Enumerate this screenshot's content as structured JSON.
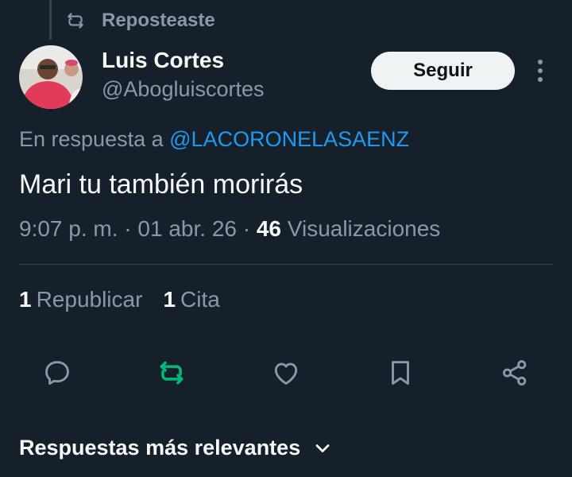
{
  "repost_banner": {
    "label": "Reposteaste",
    "icon": "repost-icon"
  },
  "author": {
    "name": "Luis Cortes",
    "handle": "@Abogluiscortes",
    "follow_label": "Seguir"
  },
  "reply_context": {
    "prefix": "En respuesta a",
    "mention": "@LACORONELASAENZ"
  },
  "tweet": {
    "text": "Mari tu también morirás",
    "time": "9:07 p. m.",
    "date": "01 abr. 26",
    "views_count": "46",
    "views_label": "Visualizaciones"
  },
  "stats": {
    "reposts_count": "1",
    "reposts_label": "Republicar",
    "quotes_count": "1",
    "quotes_label": "Cita"
  },
  "actions": [
    "reply-icon",
    "repost-icon",
    "like-icon",
    "bookmark-icon",
    "share-icon"
  ],
  "replies_sort": {
    "label": "Respuestas más relevantes"
  },
  "colors": {
    "background": "#15202b",
    "text_primary": "#f7f9f9",
    "text_secondary": "#8b98a5",
    "link": "#1d9bf0",
    "repost_active": "#00ba7c",
    "divider": "#38444d"
  }
}
